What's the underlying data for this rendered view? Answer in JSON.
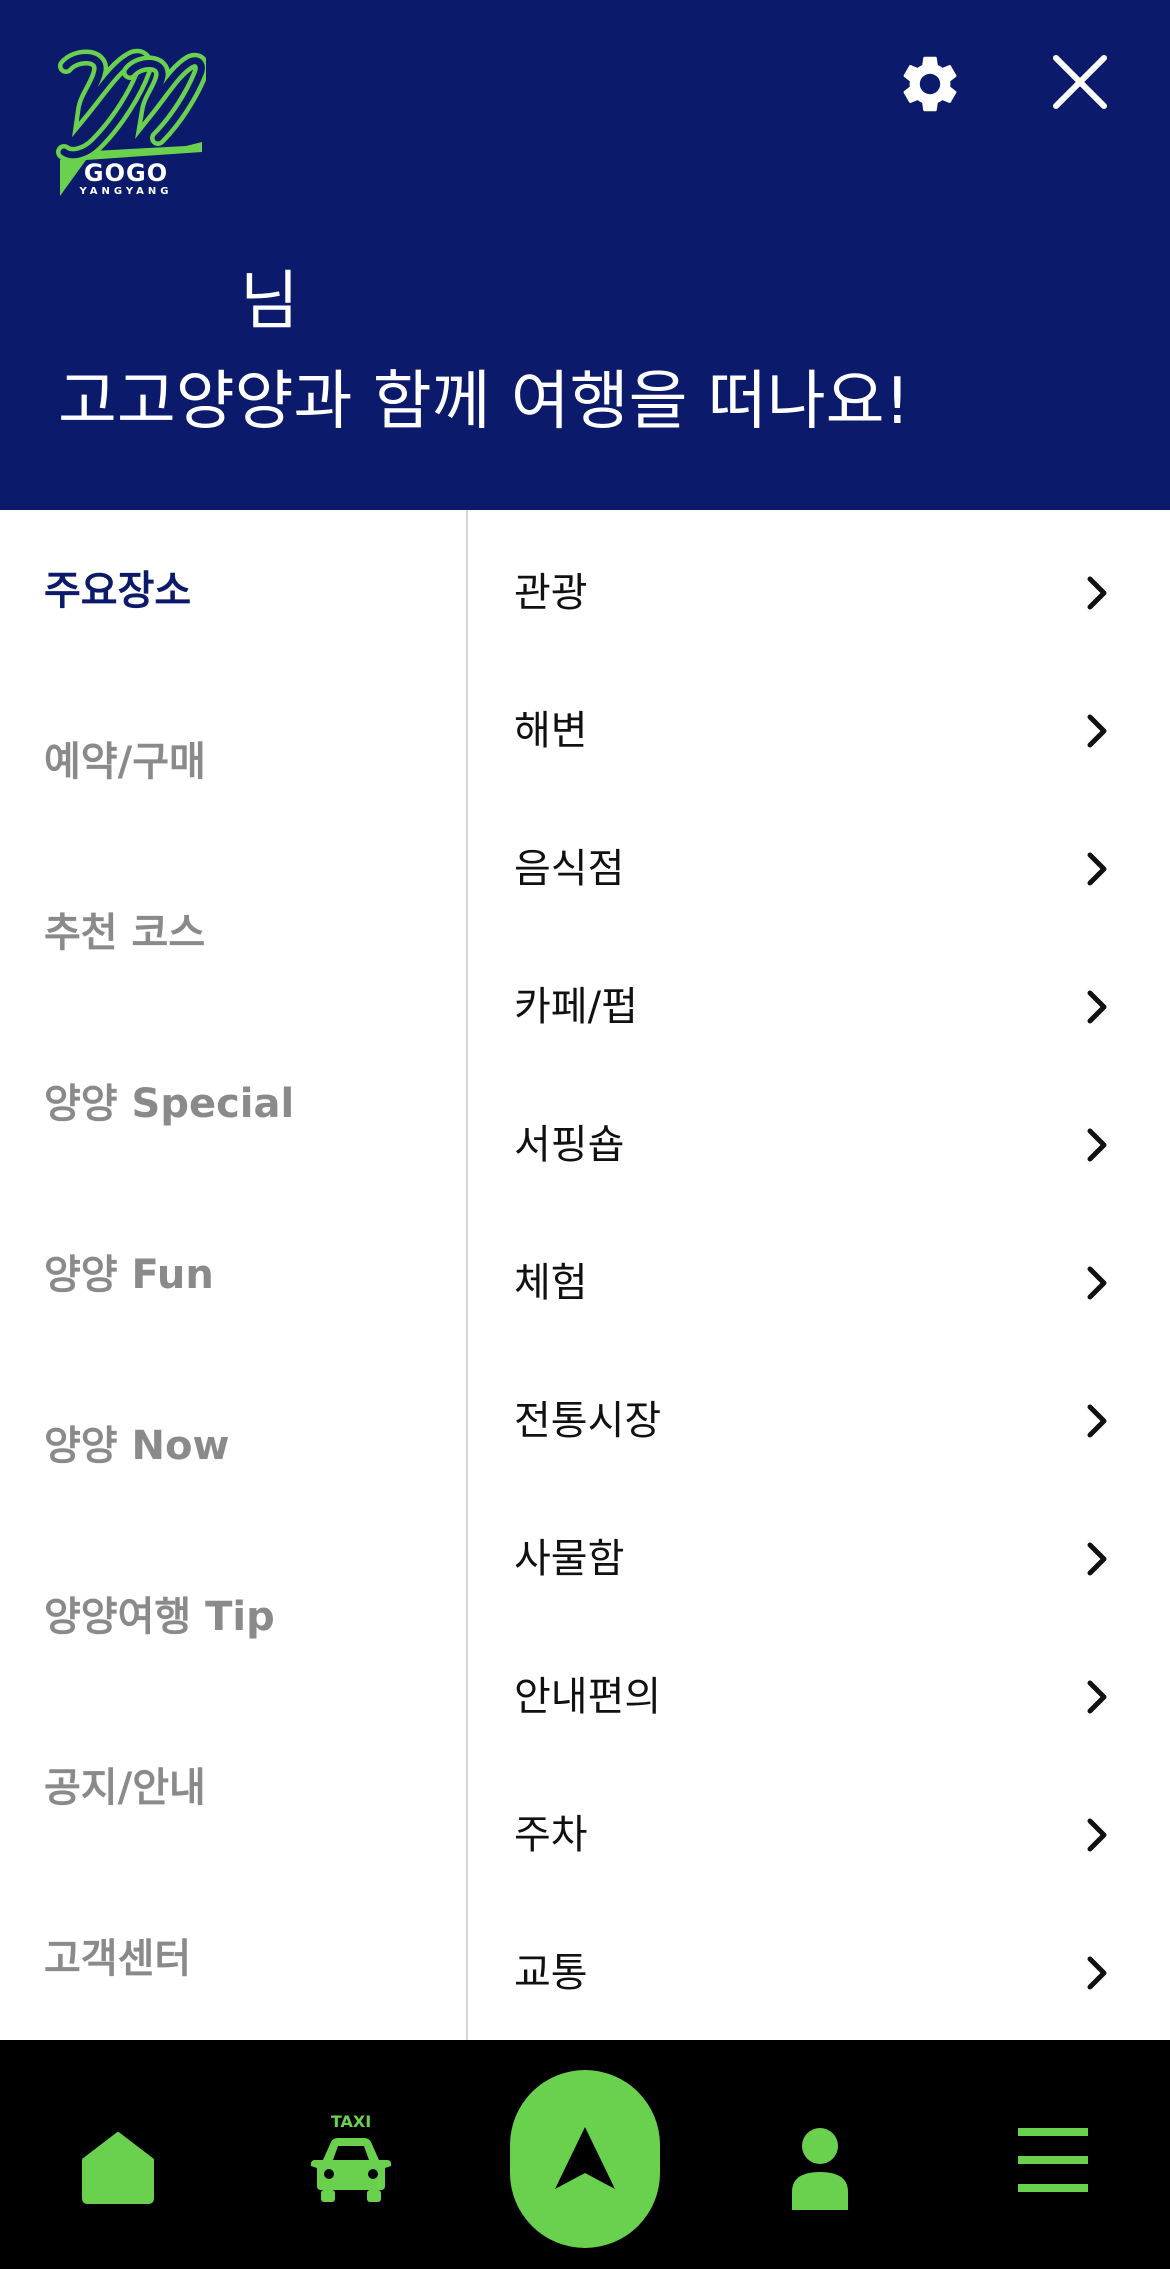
{
  "header": {
    "logo_main": "GOGO",
    "logo_sub": "YANGYANG",
    "user_suffix": "님",
    "greeting": "고고양양과 함께 여행을 떠나요!"
  },
  "categories": [
    {
      "label": "주요장소",
      "active": true
    },
    {
      "label": "예약/구매",
      "active": false
    },
    {
      "label": "추천 코스",
      "active": false
    },
    {
      "label": "양양 Special",
      "active": false
    },
    {
      "label": "양양 Fun",
      "active": false
    },
    {
      "label": "양양 Now",
      "active": false
    },
    {
      "label": "양양여행 Tip",
      "active": false
    },
    {
      "label": "공지/안내",
      "active": false
    },
    {
      "label": "고객센터",
      "active": false
    }
  ],
  "subcategories": [
    {
      "label": "관광"
    },
    {
      "label": "해변"
    },
    {
      "label": "음식점"
    },
    {
      "label": "카페/펍"
    },
    {
      "label": "서핑숍"
    },
    {
      "label": "체험"
    },
    {
      "label": "전통시장"
    },
    {
      "label": "사물함"
    },
    {
      "label": "안내편의"
    },
    {
      "label": "주차"
    },
    {
      "label": "교통"
    }
  ],
  "bottom_nav": {
    "taxi_label": "TAXI",
    "items": [
      "home-icon",
      "taxi-icon",
      "navigation-arrow-icon",
      "profile-icon",
      "menu-icon"
    ]
  },
  "colors": {
    "header_bg": "#0b1a6b",
    "accent_green": "#6ad14f",
    "active_category": "#0b1a6b",
    "inactive_category": "#8a8a8a",
    "nav_bg": "#000000"
  }
}
